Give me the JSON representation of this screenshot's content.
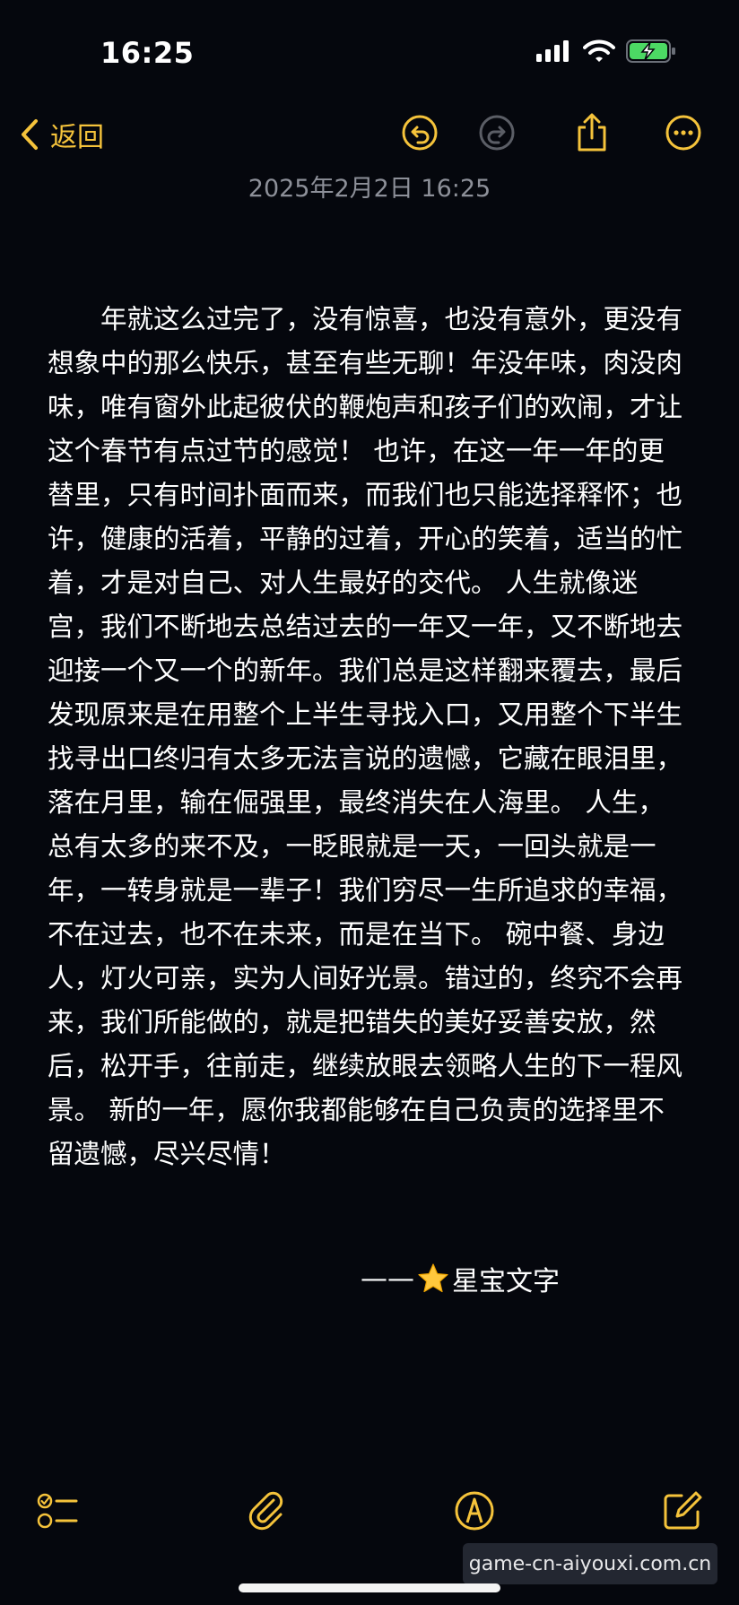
{
  "status_bar": {
    "time": "16:25"
  },
  "nav": {
    "back_label": "返回"
  },
  "note": {
    "date": "2025年2月2日 16:25",
    "body": "　　年就这么过完了，没有惊喜，也没有意外，更没有想象中的那么快乐，甚至有些无聊！年没年味，肉没肉味，唯有窗外此起彼伏的鞭炮声和孩子们的欢闹，才让这个春节有点过节的感觉！ 也许，在这一年一年的更替里，只有时间扑面而来，而我们也只能选择释怀；也许，健康的活着，平静的过着，开心的笑着，适当的忙着，才是对自己、对人生最好的交代。 人生就像迷宫，我们不断地去总结过去的一年又一年，又不断地去迎接一个又一个的新年。我们总是这样翻来覆去，最后发现原来是在用整个上半生寻找入口，又用整个下半生找寻出口终归有太多无法言说的遗憾，它藏在眼泪里，落在月里，输在倔强里，最终消失在人海里。 人生，总有太多的来不及，一眨眼就是一天，一回头就是一年，一转身就是一辈子！我们穷尽一生所追求的幸福，不在过去，也不在未来，而是在当下。 碗中餐、身边人，灯火可亲，实为人间好光景。错过的，终究不会再来，我们所能做的，就是把错失的美好妥善安放，然后，松开手，往前走，继续放眼去领略人生的下一程风景。 新的一年，愿你我都能够在自己负责的选择里不留遗憾，尽兴尽情！",
    "signature_dash": "——",
    "signature_text": "星宝文字"
  },
  "watermark": {
    "text": "game-cn-aiyouxi.com.cn"
  },
  "colors": {
    "accent": "#f5c33b",
    "background": "#05070d",
    "muted": "#8d9099",
    "battery": "#4cd964"
  },
  "icons": {
    "nav": [
      "chevron-left-icon",
      "undo-icon",
      "redo-icon",
      "share-icon",
      "more-icon"
    ],
    "toolbar": [
      "checklist-icon",
      "paperclip-icon",
      "markup-pen-icon",
      "compose-icon"
    ]
  }
}
